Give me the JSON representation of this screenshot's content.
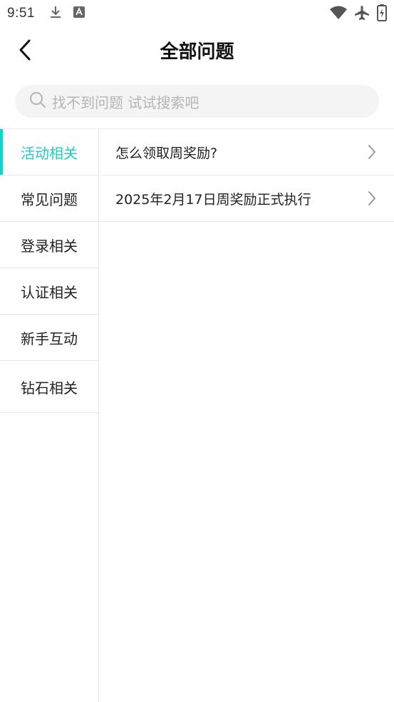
{
  "status_bar": {
    "time": "9:51",
    "icons": [
      "download-icon",
      "a-box-icon",
      "wifi-icon",
      "airplane-mode-icon",
      "battery-icon"
    ]
  },
  "header": {
    "title": "全部问题",
    "back_icon": "chevron-left-icon"
  },
  "search": {
    "placeholder": "找不到问题 试试搜索吧",
    "icon": "search-icon"
  },
  "sidebar": {
    "items": [
      {
        "label": "活动相关",
        "active": true
      },
      {
        "label": "常见问题",
        "active": false
      },
      {
        "label": "登录相关",
        "active": false
      },
      {
        "label": "认证相关",
        "active": false
      },
      {
        "label": "新手互动",
        "active": false
      },
      {
        "label": "钻石相关",
        "active": false
      }
    ]
  },
  "questions": [
    {
      "title": "怎么领取周奖励?"
    },
    {
      "title": "2025年2月17日周奖励正式执行"
    }
  ],
  "colors": {
    "accent": "#19d1c0",
    "divider": "#e6e6e6",
    "search_bg": "#f4f4f4",
    "placeholder": "#b5b5b5"
  }
}
